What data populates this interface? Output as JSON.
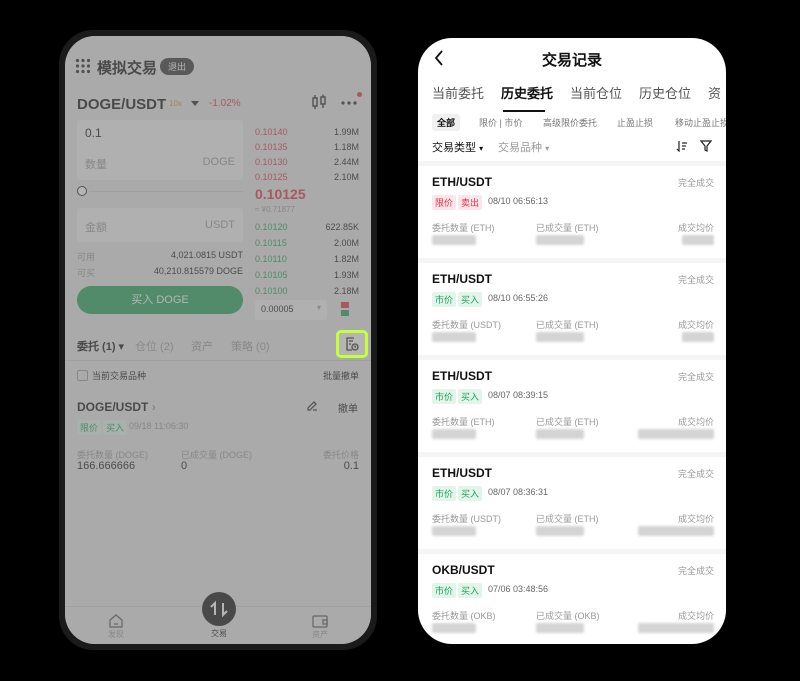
{
  "left": {
    "header": {
      "title": "模拟交易",
      "exit_label": "退出"
    },
    "pair": {
      "name": "DOGE/USDT",
      "leverage": "10x",
      "change": "-1.02%"
    },
    "order": {
      "price_value": "0.1",
      "qty_placeholder": "数量",
      "qty_unit": "DOGE",
      "amount_placeholder": "金额",
      "amount_unit": "USDT",
      "avail_label": "可用",
      "avail_value": "4,021.0815 USDT",
      "canbuy_label": "可买",
      "canbuy_value": "40,210.815579 DOGE",
      "buy_label": "买入 DOGE"
    },
    "book": {
      "asks": [
        {
          "price": "0.10140",
          "qty": "1.99M"
        },
        {
          "price": "0.10135",
          "qty": "1.18M"
        },
        {
          "price": "0.10130",
          "qty": "2.44M"
        },
        {
          "price": "0.10125",
          "qty": "2.10M"
        }
      ],
      "last": "0.10125",
      "last_fiat": "≈ ¥0.71877",
      "bids": [
        {
          "price": "0.10120",
          "qty": "622.85K"
        },
        {
          "price": "0.10115",
          "qty": "2.00M"
        },
        {
          "price": "0.10110",
          "qty": "1.82M"
        },
        {
          "price": "0.10105",
          "qty": "1.93M"
        },
        {
          "price": "0.10100",
          "qty": "2.18M"
        }
      ],
      "precision": "0.00005"
    },
    "tabs": [
      "委托 (1)",
      "仓位 (2)",
      "资产",
      "策略 (0)"
    ],
    "filter": {
      "current_pair_label": "当前交易品种",
      "batch_cancel_label": "批量撤单"
    },
    "open_order": {
      "pair": "DOGE/USDT",
      "type": "限价",
      "side": "买入",
      "time": "09/18 11:06:30",
      "cancel_label": "撤单",
      "qty_label": "委托数量 (DOGE)",
      "qty_value": "166.666666",
      "filled_label": "已成交量 (DOGE)",
      "filled_value": "0",
      "price_label": "委托价格",
      "price_value": "0.1"
    },
    "bottom_nav": {
      "discover": "发现",
      "trade": "交易",
      "assets": "资产"
    }
  },
  "right": {
    "title": "交易记录",
    "tabs": [
      "当前委托",
      "历史委托",
      "当前仓位",
      "历史仓位",
      "资"
    ],
    "subtabs": [
      "全部",
      "限价 | 市价",
      "高级限价委托",
      "止盈止损",
      "移动止盈止损"
    ],
    "filters": {
      "type_label": "交易类型",
      "product_label": "交易品种"
    },
    "records": [
      {
        "pair": "ETH/USDT",
        "status": "完全成交",
        "type": "限价",
        "side": "卖出",
        "side_color": "red",
        "time": "08/10 06:56:13",
        "qty_label": "委托数量 (ETH)",
        "filled_label": "已成交量 (ETH)",
        "avg_label": "成交均价"
      },
      {
        "pair": "ETH/USDT",
        "status": "完全成交",
        "type": "市价",
        "side": "买入",
        "side_color": "green",
        "time": "08/10 06:55:26",
        "qty_label": "委托数量 (USDT)",
        "filled_label": "已成交量 (ETH)",
        "avg_label": "成交均价"
      },
      {
        "pair": "ETH/USDT",
        "status": "完全成交",
        "type": "市价",
        "side": "买入",
        "side_color": "green",
        "time": "08/07 08:39:15",
        "qty_label": "委托数量 (ETH)",
        "filled_label": "已成交量 (ETH)",
        "avg_label": "成交均价"
      },
      {
        "pair": "ETH/USDT",
        "status": "完全成交",
        "type": "市价",
        "side": "买入",
        "side_color": "green",
        "time": "08/07 08:36:31",
        "qty_label": "委托数量 (USDT)",
        "filled_label": "已成交量 (ETH)",
        "avg_label": "成交均价"
      },
      {
        "pair": "OKB/USDT",
        "status": "完全成交",
        "type": "市价",
        "side": "买入",
        "side_color": "green",
        "time": "07/06 03:48:56",
        "qty_label": "委托数量 (OKB)",
        "filled_label": "已成交量 (OKB)",
        "avg_label": "成交均价"
      }
    ]
  }
}
